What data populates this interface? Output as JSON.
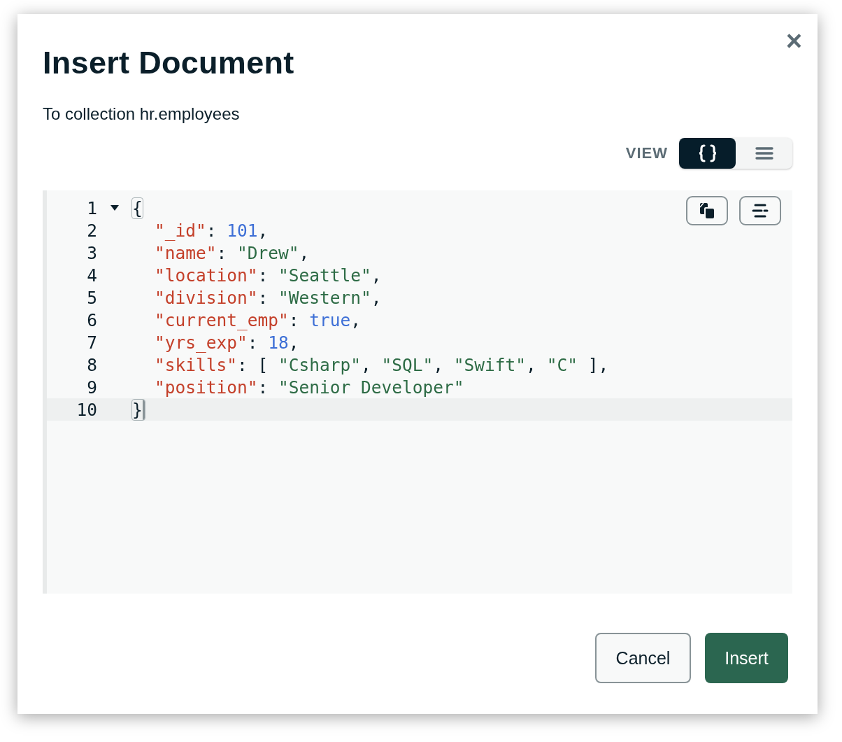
{
  "dialog": {
    "title": "Insert Document",
    "subtitle": "To collection hr.employees",
    "close": "×"
  },
  "view": {
    "label": "VIEW",
    "options": [
      {
        "kind": "json",
        "selected": true
      },
      {
        "kind": "list",
        "selected": false
      }
    ]
  },
  "editor": {
    "tools": [
      {
        "kind": "copy"
      },
      {
        "kind": "format"
      }
    ],
    "lines": [
      {
        "number": "1",
        "foldable": true,
        "active": false,
        "indented": false,
        "tokens": [
          {
            "kind": "bracket",
            "text": "{",
            "matched": true
          }
        ]
      },
      {
        "number": "2",
        "foldable": false,
        "active": false,
        "indented": true,
        "tokens": [
          {
            "kind": "key",
            "text": "\"_id\""
          },
          {
            "kind": "punct",
            "text": ": "
          },
          {
            "kind": "number",
            "text": "101"
          },
          {
            "kind": "punct",
            "text": ","
          }
        ]
      },
      {
        "number": "3",
        "foldable": false,
        "active": false,
        "indented": true,
        "tokens": [
          {
            "kind": "key",
            "text": "\"name\""
          },
          {
            "kind": "punct",
            "text": ": "
          },
          {
            "kind": "string",
            "text": "\"Drew\""
          },
          {
            "kind": "punct",
            "text": ","
          }
        ]
      },
      {
        "number": "4",
        "foldable": false,
        "active": false,
        "indented": true,
        "tokens": [
          {
            "kind": "key",
            "text": "\"location\""
          },
          {
            "kind": "punct",
            "text": ": "
          },
          {
            "kind": "string",
            "text": "\"Seattle\""
          },
          {
            "kind": "punct",
            "text": ","
          }
        ]
      },
      {
        "number": "5",
        "foldable": false,
        "active": false,
        "indented": true,
        "tokens": [
          {
            "kind": "key",
            "text": "\"division\""
          },
          {
            "kind": "punct",
            "text": ": "
          },
          {
            "kind": "string",
            "text": "\"Western\""
          },
          {
            "kind": "punct",
            "text": ","
          }
        ]
      },
      {
        "number": "6",
        "foldable": false,
        "active": false,
        "indented": true,
        "tokens": [
          {
            "kind": "key",
            "text": "\"current_emp\""
          },
          {
            "kind": "punct",
            "text": ": "
          },
          {
            "kind": "number",
            "text": "true"
          },
          {
            "kind": "punct",
            "text": ","
          }
        ]
      },
      {
        "number": "7",
        "foldable": false,
        "active": false,
        "indented": true,
        "tokens": [
          {
            "kind": "key",
            "text": "\"yrs_exp\""
          },
          {
            "kind": "punct",
            "text": ": "
          },
          {
            "kind": "number",
            "text": "18"
          },
          {
            "kind": "punct",
            "text": ","
          }
        ]
      },
      {
        "number": "8",
        "foldable": false,
        "active": false,
        "indented": true,
        "tokens": [
          {
            "kind": "key",
            "text": "\"skills\""
          },
          {
            "kind": "punct",
            "text": ": [ "
          },
          {
            "kind": "string",
            "text": "\"Csharp\""
          },
          {
            "kind": "punct",
            "text": ", "
          },
          {
            "kind": "string",
            "text": "\"SQL\""
          },
          {
            "kind": "punct",
            "text": ", "
          },
          {
            "kind": "string",
            "text": "\"Swift\""
          },
          {
            "kind": "punct",
            "text": ", "
          },
          {
            "kind": "string",
            "text": "\"C\""
          },
          {
            "kind": "punct",
            "text": " ],"
          }
        ]
      },
      {
        "number": "9",
        "foldable": false,
        "active": false,
        "indented": true,
        "tokens": [
          {
            "kind": "key",
            "text": "\"position\""
          },
          {
            "kind": "punct",
            "text": ": "
          },
          {
            "kind": "string",
            "text": "\"Senior Developer\""
          }
        ]
      },
      {
        "number": "10",
        "foldable": false,
        "active": true,
        "indented": false,
        "tokens": [
          {
            "kind": "bracket",
            "text": "}",
            "matched": true
          }
        ]
      }
    ]
  },
  "buttons": [
    {
      "label": "Cancel",
      "kind": "secondary"
    },
    {
      "label": "Insert",
      "kind": "primary"
    }
  ]
}
